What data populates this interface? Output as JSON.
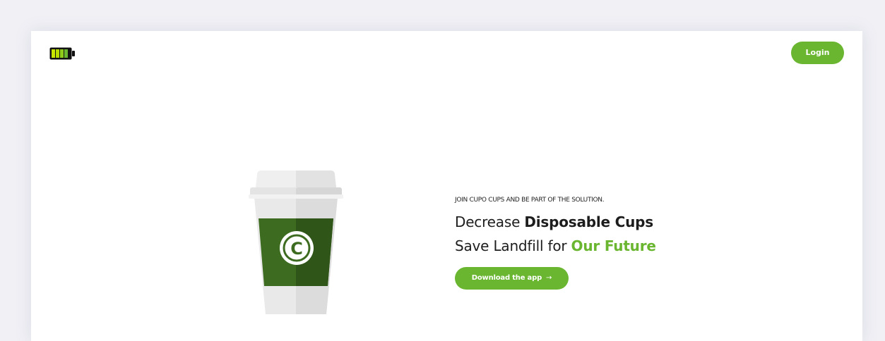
{
  "header": {
    "logo_icon": "battery-icon",
    "login_label": "Login"
  },
  "hero": {
    "tagline": "JOIN CUPO CUPS AND BE PART OF THE SOLUTION.",
    "line1_prefix": "Decrease ",
    "line1_bold": "Disposable Cups",
    "line2_prefix": "Save Landfill for ",
    "line2_accent": "Our Future",
    "download_label": "Download the app",
    "download_arrow": "→",
    "cup_logo_letter": "C"
  },
  "colors": {
    "accent": "#6ab630",
    "cup_sleeve": "#3d6b1f",
    "background": "#f0f0f5"
  }
}
